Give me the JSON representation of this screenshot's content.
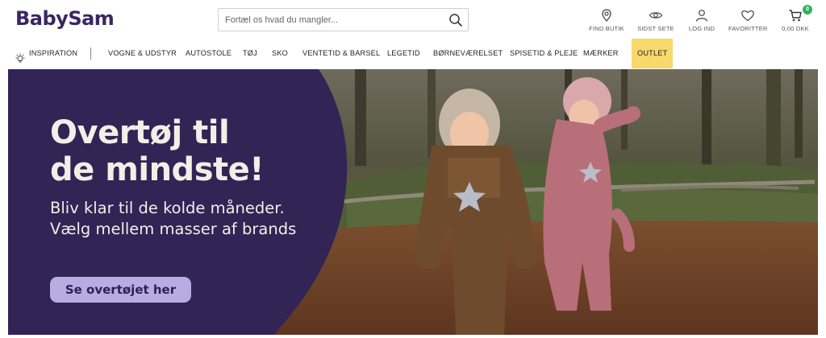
{
  "brand": {
    "logo": "BabySam",
    "primary_color": "#3a2663",
    "accent_outlet": "#f9d86b",
    "badge_color": "#2db35d"
  },
  "search": {
    "placeholder": "Fortæl os hvad du mangler...",
    "value": "",
    "icon": "search-icon"
  },
  "user_actions": [
    {
      "label": "FIND BUTIK",
      "icon": "location-pin-icon"
    },
    {
      "label": "SIDST SETE",
      "icon": "eye-icon"
    },
    {
      "label": "LOG IND",
      "icon": "user-icon"
    },
    {
      "label": "FAVORITTER",
      "icon": "heart-icon"
    },
    {
      "label": "0,00 DKK",
      "icon": "cart-icon",
      "badge": "0"
    }
  ],
  "nav": {
    "inspiration": "INSPIRATION",
    "items": [
      "VOGNE & UDSTYR",
      "AUTOSTOLE",
      "TØJ",
      "SKO",
      "VENTETID & BARSEL",
      "LEGETID",
      "BØRNEVÆRELSET",
      "SPISETID & PLEJE",
      "MÆRKER",
      "OUTLET"
    ]
  },
  "hero": {
    "title": "Overtøj til\nde mindste!",
    "subtitle": "Bliv klar til de kolde måneder.\nVælg mellem masser af brands",
    "cta": "Se overtøjet her",
    "panel_color": "#332456"
  }
}
